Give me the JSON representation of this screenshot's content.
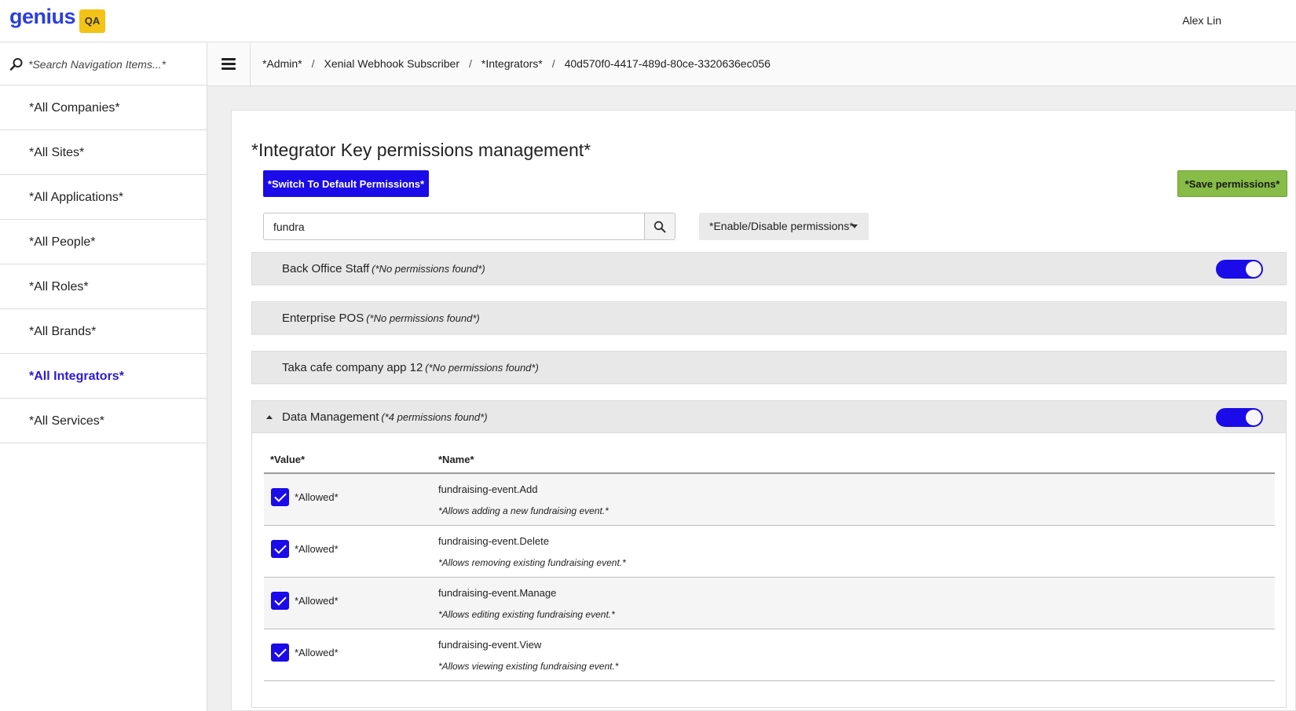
{
  "header": {
    "logo_text": "genius",
    "env_badge": "QA",
    "user_name": "Alex Lin"
  },
  "sidebar": {
    "search_placeholder": "*Search Navigation Items...*",
    "items": [
      {
        "label": "*All Companies*",
        "active": false
      },
      {
        "label": "*All Sites*",
        "active": false
      },
      {
        "label": "*All Applications*",
        "active": false
      },
      {
        "label": "*All People*",
        "active": false
      },
      {
        "label": "*All Roles*",
        "active": false
      },
      {
        "label": "*All Brands*",
        "active": false
      },
      {
        "label": "*All Integrators*",
        "active": true
      },
      {
        "label": "*All Services*",
        "active": false
      }
    ]
  },
  "breadcrumb": [
    "*Admin*",
    "Xenial Webhook Subscriber",
    "*Integrators*",
    "40d570f0-4417-489d-80ce-3320636ec056"
  ],
  "main": {
    "title": "*Integrator Key permissions management*",
    "switch_default_label": "*Switch To Default Permissions*",
    "save_label": "*Save permissions*",
    "filter_value": "fundra",
    "enable_disable_label": "*Enable/Disable permissions*",
    "panels": [
      {
        "title": "Back Office Staff",
        "note": "(*No permissions found*)",
        "toggle": true,
        "toggle_on": true
      },
      {
        "title": "Enterprise POS",
        "note": "(*No permissions found*)",
        "toggle": false
      },
      {
        "title": "Taka cafe company app 12",
        "note": "(*No permissions found*)",
        "toggle": false
      },
      {
        "title": "Data Management",
        "note": "(*4 permissions found*)",
        "toggle": true,
        "toggle_on": true,
        "expanded": true
      }
    ],
    "table": {
      "headers": {
        "value": "*Value*",
        "name": "*Name*"
      },
      "rows": [
        {
          "value": "*Allowed*",
          "checked": true,
          "name": "fundraising-event.Add",
          "desc": "*Allows adding a new fundraising event.*"
        },
        {
          "value": "*Allowed*",
          "checked": true,
          "name": "fundraising-event.Delete",
          "desc": "*Allows removing existing fundraising event.*"
        },
        {
          "value": "*Allowed*",
          "checked": true,
          "name": "fundraising-event.Manage",
          "desc": "*Allows editing existing fundraising event.*"
        },
        {
          "value": "*Allowed*",
          "checked": true,
          "name": "fundraising-event.View",
          "desc": "*Allows viewing existing fundraising event.*"
        }
      ]
    }
  },
  "colors": {
    "primary": "#1a0be8",
    "save_green": "#86bc47",
    "logo_blue": "#2b3ee0",
    "badge_yellow": "#f3c316"
  }
}
